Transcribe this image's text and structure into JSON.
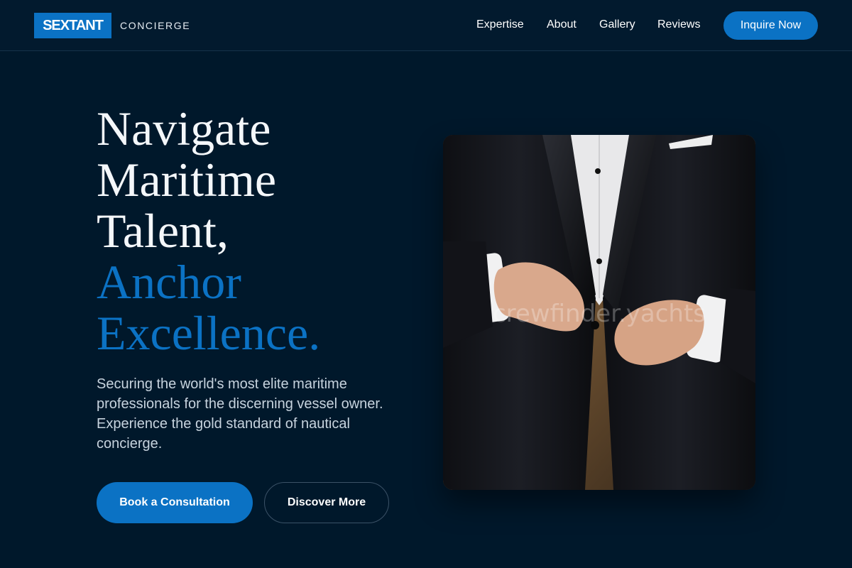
{
  "brand": {
    "logo": "SEXTANT",
    "subtitle": "CONCIERGE",
    "accent_color": "#0b72c4",
    "background_color": "#00182b"
  },
  "nav": {
    "links": [
      "Expertise",
      "About",
      "Gallery",
      "Reviews"
    ],
    "cta_label": "Inquire Now"
  },
  "hero": {
    "headline_lines": [
      "Navigate",
      "Maritime",
      "Talent,"
    ],
    "headline_accent_lines": [
      "Anchor",
      "Excellence."
    ],
    "description": "Securing the world's most elite maritime professionals for the discerning vessel owner. Experience the gold standard of nautical concierge.",
    "primary_button": "Book a Consultation",
    "secondary_button": "Discover More"
  },
  "image": {
    "watermark": "crewfinder.yachts"
  }
}
